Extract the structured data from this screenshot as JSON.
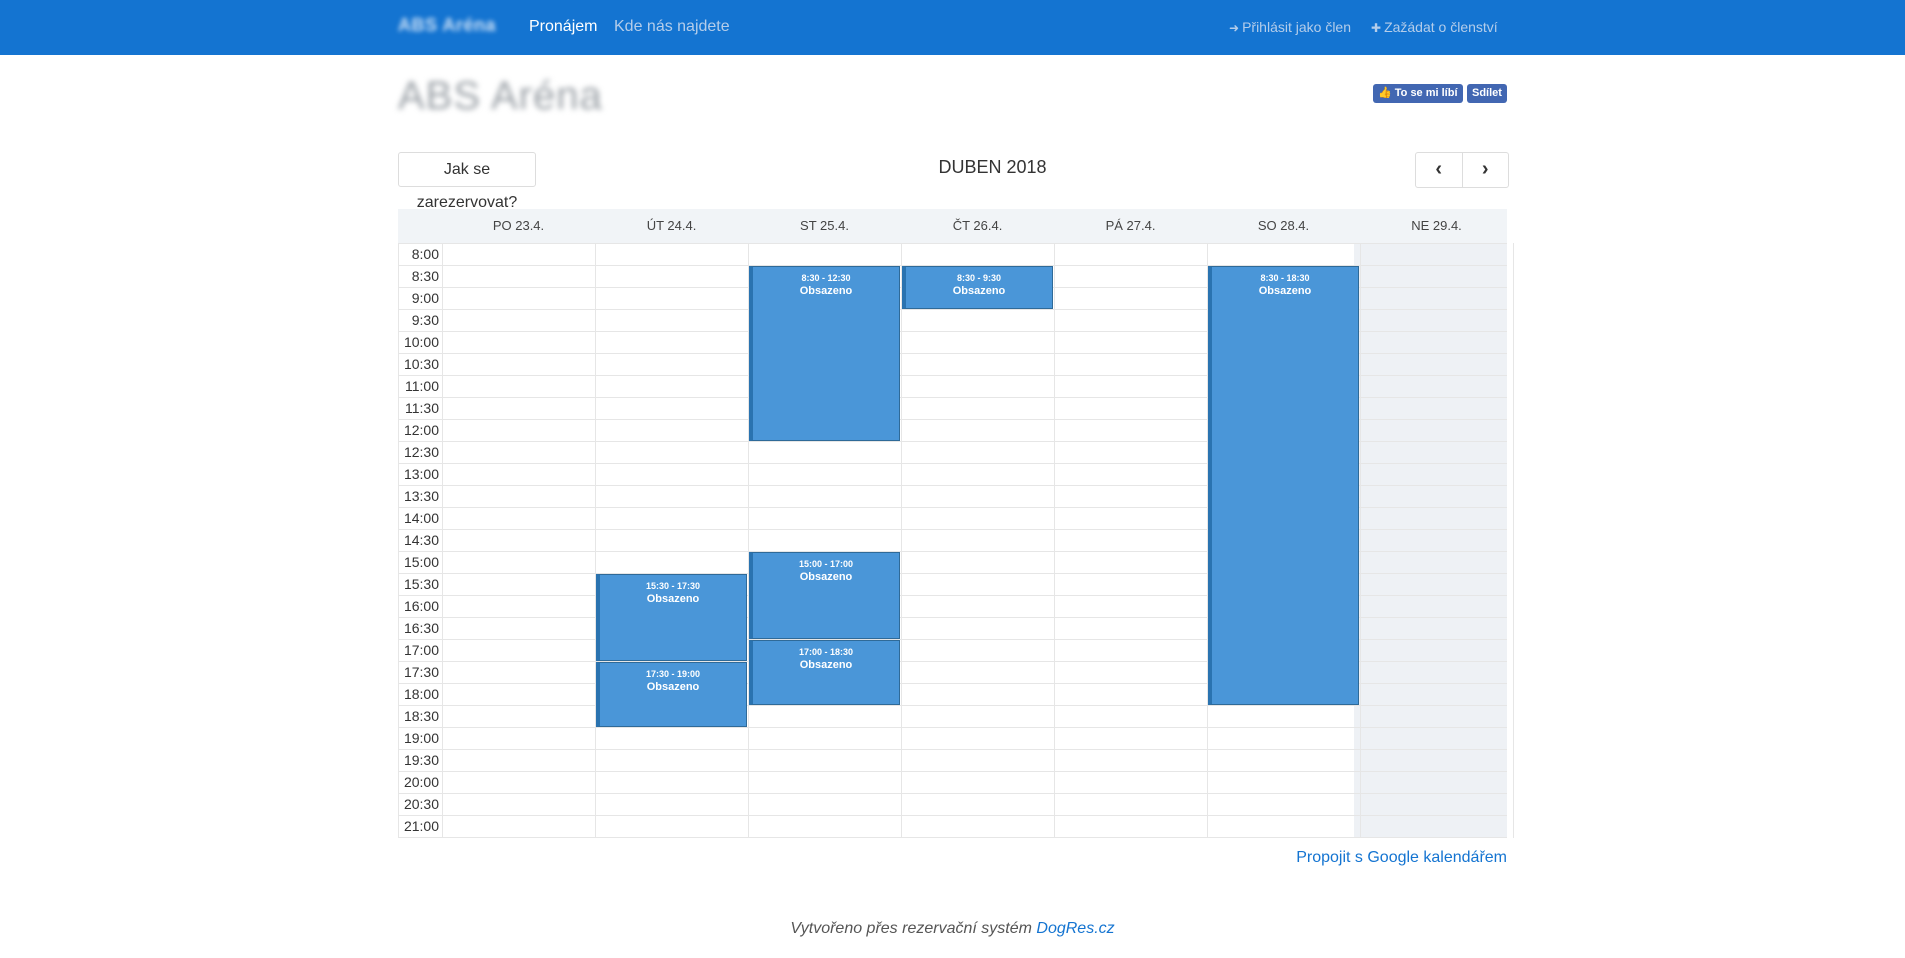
{
  "navbar": {
    "brand": "ABS Aréna",
    "links": [
      "Pronájem",
      "Kde nás najdete"
    ],
    "right": [
      {
        "icon": "sign-in-icon",
        "label": "Přihlásit jako člen"
      },
      {
        "icon": "plus-icon",
        "label": "Zažádat o členství"
      }
    ]
  },
  "page": {
    "title": "ABS Aréna",
    "fb_like": "To se mi líbí",
    "fb_share": "Sdílet"
  },
  "calendar": {
    "how_button": "Jak se zarezervovat?",
    "month": "DUBEN 2018",
    "prev": "‹",
    "next": "›",
    "days": [
      "PO 23.4.",
      "ÚT 24.4.",
      "ST 25.4.",
      "ČT 26.4.",
      "PÁ 27.4.",
      "SO 28.4.",
      "NE 29.4."
    ],
    "times": [
      "8:00",
      "8:30",
      "9:00",
      "9:30",
      "10:00",
      "10:30",
      "11:00",
      "11:30",
      "12:00",
      "12:30",
      "13:00",
      "13:30",
      "14:00",
      "14:30",
      "15:00",
      "15:30",
      "16:00",
      "16:30",
      "17:00",
      "17:30",
      "18:00",
      "18:30",
      "19:00",
      "19:30",
      "20:00",
      "20:30",
      "21:00"
    ],
    "events": [
      {
        "day": 2,
        "start": "8:30",
        "end": "12:30",
        "time": "8:30 - 12:30",
        "title": "Obsazeno"
      },
      {
        "day": 3,
        "start": "8:30",
        "end": "9:30",
        "time": "8:30 - 9:30",
        "title": "Obsazeno"
      },
      {
        "day": 5,
        "start": "8:30",
        "end": "18:30",
        "time": "8:30 - 18:30",
        "title": "Obsazeno"
      },
      {
        "day": 1,
        "start": "15:30",
        "end": "17:30",
        "time": "15:30 - 17:30",
        "title": "Obsazeno"
      },
      {
        "day": 1,
        "start": "17:30",
        "end": "19:00",
        "time": "17:30 - 19:00",
        "title": "Obsazeno"
      },
      {
        "day": 2,
        "start": "15:00",
        "end": "17:00",
        "time": "15:00 - 17:00",
        "title": "Obsazeno"
      },
      {
        "day": 2,
        "start": "17:00",
        "end": "18:30",
        "time": "17:00 - 18:30",
        "title": "Obsazeno"
      }
    ],
    "google_link": "Propojit s Google kalendářem"
  },
  "footer": {
    "text": "Vytvořeno přes rezervační systém",
    "link": "DogRes.cz"
  },
  "colors": {
    "navbar": "#1474d1",
    "event": "#4a96d8",
    "facebook": "#4267b2"
  }
}
